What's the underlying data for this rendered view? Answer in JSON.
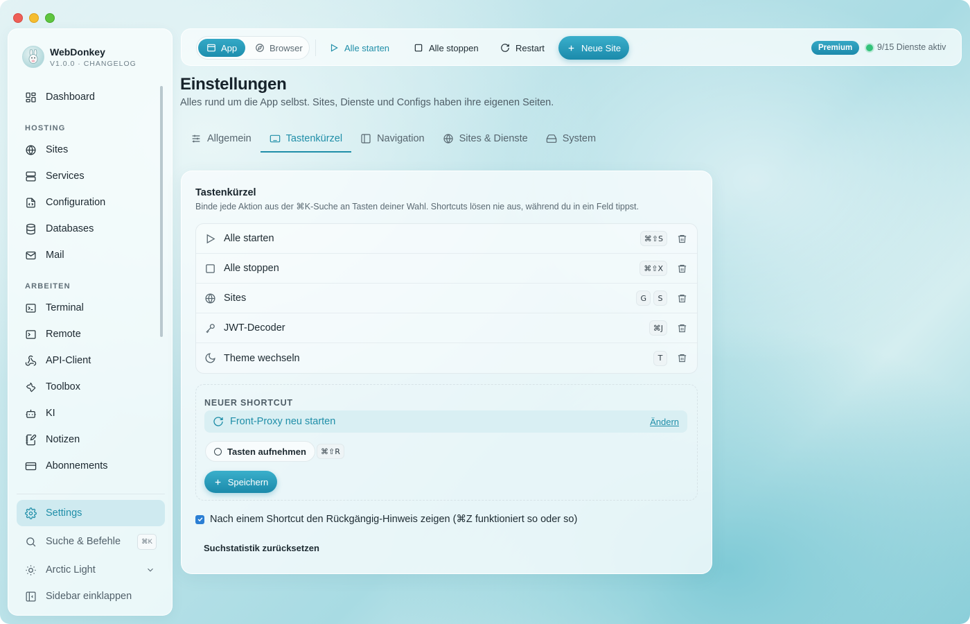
{
  "app": {
    "name": "WebDonkey",
    "version_line": "V1.0.0 · CHANGELOG"
  },
  "sidebar": {
    "items_top": [
      {
        "label": "Dashboard",
        "icon": "dashboard-icon"
      }
    ],
    "section_hosting": "HOSTING",
    "items_hosting": [
      {
        "label": "Sites",
        "icon": "globe-icon"
      },
      {
        "label": "Services",
        "icon": "server-icon"
      },
      {
        "label": "Configuration",
        "icon": "config-file-icon"
      },
      {
        "label": "Databases",
        "icon": "database-icon"
      },
      {
        "label": "Mail",
        "icon": "mail-icon"
      }
    ],
    "section_arbeiten": "ARBEITEN",
    "items_arbeiten": [
      {
        "label": "Terminal",
        "icon": "terminal-icon"
      },
      {
        "label": "Remote",
        "icon": "remote-terminal-icon"
      },
      {
        "label": "API-Client",
        "icon": "webhook-icon"
      },
      {
        "label": "Toolbox",
        "icon": "wrench-icon"
      },
      {
        "label": "KI",
        "icon": "bot-icon"
      },
      {
        "label": "Notizen",
        "icon": "notebook-pen-icon"
      },
      {
        "label": "Abonnements",
        "icon": "credit-card-icon"
      }
    ],
    "settings_label": "Settings",
    "search_label": "Suche & Befehle",
    "search_shortcut": "⌘K",
    "theme_label": "Arctic Light",
    "collapse_label": "Sidebar einklappen"
  },
  "toolbar": {
    "mode_app": "App",
    "mode_browser": "Browser",
    "start_all": "Alle starten",
    "stop_all": "Alle stoppen",
    "restart": "Restart",
    "new_site": "Neue Site",
    "premium_badge": "Premium",
    "status_text": "9/15 Dienste aktiv"
  },
  "page": {
    "title": "Einstellungen",
    "subtitle": "Alles rund um die App selbst. Sites, Dienste und Configs haben ihre eigenen Seiten.",
    "tabs": [
      {
        "label": "Allgemein",
        "icon": "sliders-icon"
      },
      {
        "label": "Tastenkürzel",
        "icon": "keyboard-icon",
        "active": true
      },
      {
        "label": "Navigation",
        "icon": "panel-left-icon"
      },
      {
        "label": "Sites & Dienste",
        "icon": "globe-icon"
      },
      {
        "label": "System",
        "icon": "hard-drive-icon"
      }
    ]
  },
  "shortcuts": {
    "title": "Tastenkürzel",
    "description": "Binde jede Aktion aus der ⌘K-Suche an Tasten deiner Wahl. Shortcuts lösen nie aus, während du in ein Feld tippst.",
    "rows": [
      {
        "label": "Alle starten",
        "icon": "play-icon",
        "keys": [
          "⌘⇧S"
        ]
      },
      {
        "label": "Alle stoppen",
        "icon": "square-icon",
        "keys": [
          "⌘⇧X"
        ]
      },
      {
        "label": "Sites",
        "icon": "globe-icon",
        "keys": [
          "G",
          "S"
        ]
      },
      {
        "label": "JWT-Decoder",
        "icon": "key-icon",
        "keys": [
          "⌘J"
        ]
      },
      {
        "label": "Theme wechseln",
        "icon": "moon-icon",
        "keys": [
          "T"
        ]
      }
    ],
    "new_section_label": "NEUER SHORTCUT",
    "new_action": "Front-Proxy neu starten",
    "change_link": "Ändern",
    "record_label": "Tasten aufnehmen",
    "recorded_keys": "⌘⇧R",
    "save_label": "Speichern",
    "undo_hint_label": "Nach einem Shortcut den Rückgängig-Hinweis zeigen (⌘Z funktioniert so oder so)",
    "undo_hint_checked": true,
    "reset_stats_label": "Suchstatistik zurücksetzen"
  },
  "colors": {
    "accent": "#1f8ea8",
    "status_ok": "#33c27a"
  }
}
